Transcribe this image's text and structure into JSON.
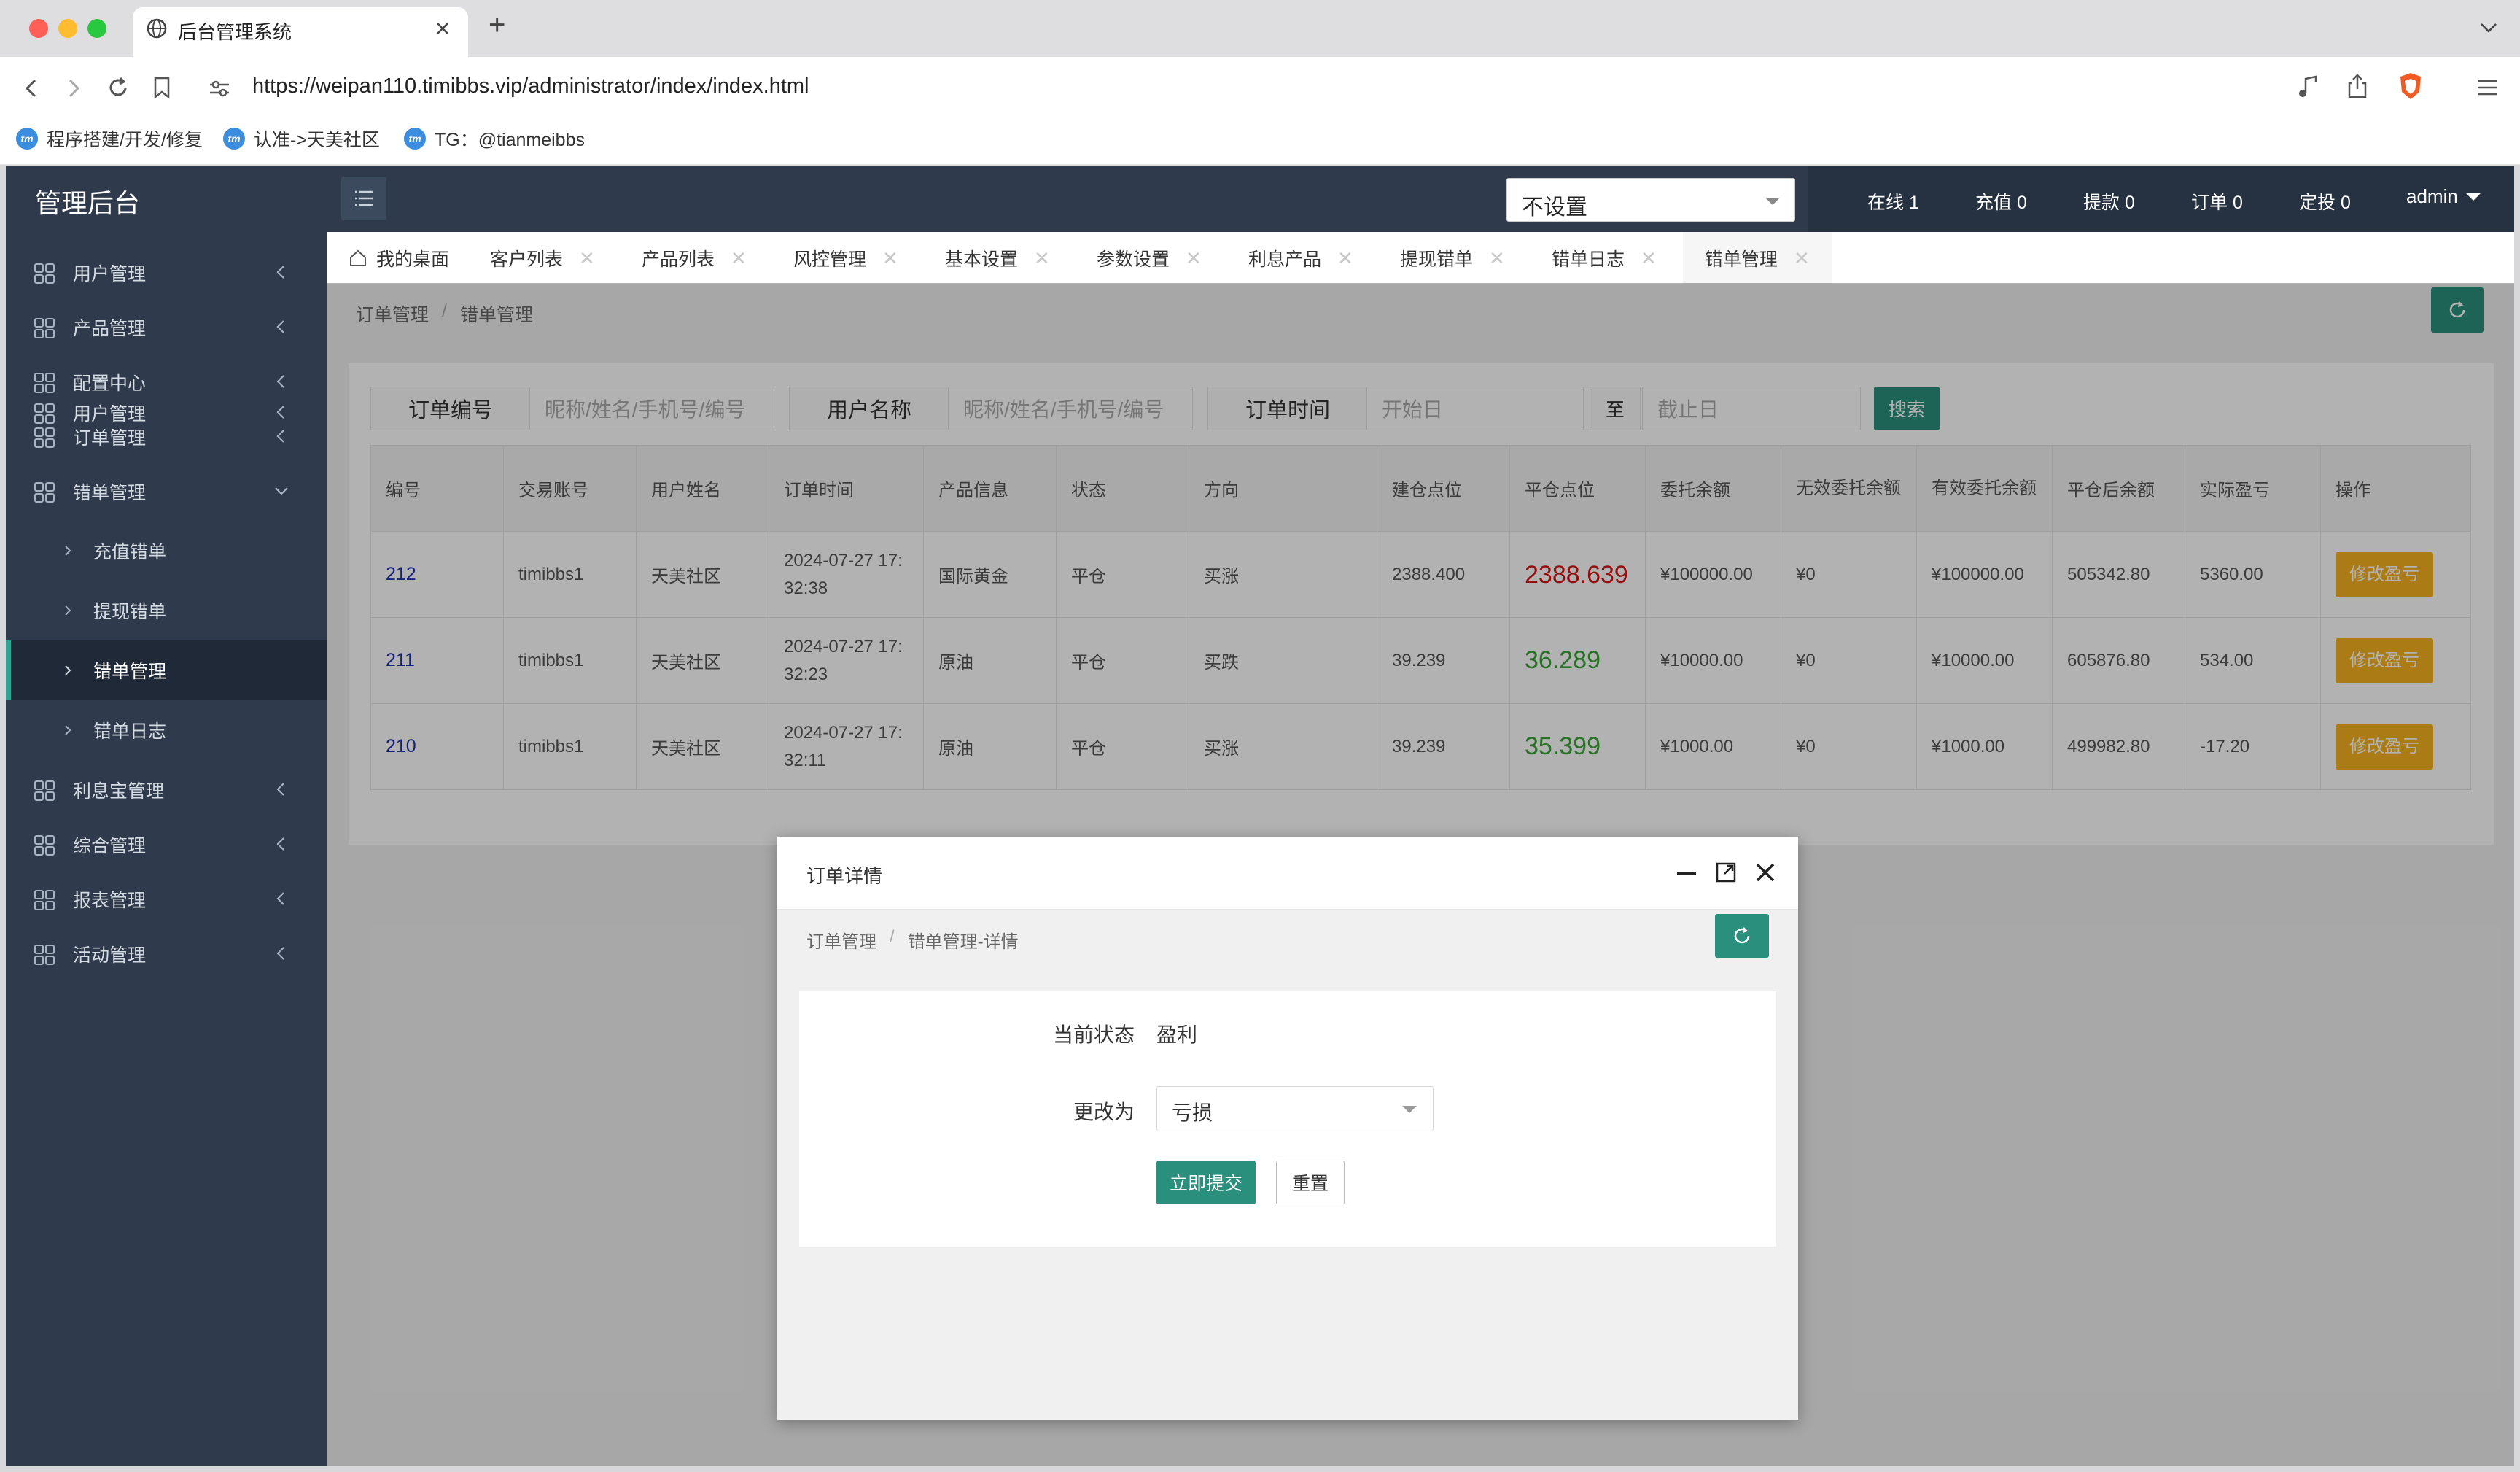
{
  "browser": {
    "tab_title": "后台管理系统",
    "new_tab": "+",
    "url": "https://weipan110.timibbs.vip/administrator/index/index.html",
    "bookmarks": [
      "程序搭建/开发/修复",
      "认准->天美社区",
      "TG：@tianmeibbs"
    ],
    "bookmark_icon_text": "tm"
  },
  "sidebar": {
    "logo": "管理后台",
    "menu": [
      {
        "label": "用户管理"
      },
      {
        "label": "产品管理"
      },
      {
        "label": "配置中心"
      },
      {
        "label": "订单管理"
      },
      {
        "label": "错单管理"
      }
    ],
    "submenu": [
      {
        "label": "充值错单"
      },
      {
        "label": "提现错单"
      },
      {
        "label": "错单管理"
      },
      {
        "label": "错单日志"
      }
    ],
    "menu2": [
      {
        "label": "利息宝管理"
      },
      {
        "label": "综合管理"
      },
      {
        "label": "报表管理"
      },
      {
        "label": "活动管理"
      }
    ]
  },
  "topbar": {
    "select_value": "不设置",
    "stats": [
      "在线 1",
      "充值 0",
      "提款 0",
      "订单 0",
      "定投 0"
    ],
    "user": "admin"
  },
  "tabs": [
    {
      "label": "我的桌面"
    },
    {
      "label": "客户列表"
    },
    {
      "label": "产品列表"
    },
    {
      "label": "风控管理"
    },
    {
      "label": "基本设置"
    },
    {
      "label": "参数设置"
    },
    {
      "label": "利息产品"
    },
    {
      "label": "提现错单"
    },
    {
      "label": "错单日志"
    },
    {
      "label": "错单管理"
    }
  ],
  "breadcrumb": {
    "a": "订单管理",
    "sep": "/",
    "b": "错单管理"
  },
  "search": {
    "order_no_label": "订单编号",
    "order_no_placeholder": "昵称/姓名/手机号/编号",
    "user_label": "用户名称",
    "user_placeholder": "昵称/姓名/手机号/编号",
    "time_label": "订单时间",
    "start_placeholder": "开始日",
    "to": "至",
    "end_placeholder": "截止日",
    "search_button": "搜索"
  },
  "table": {
    "headers": [
      "编号",
      "交易账号",
      "用户姓名",
      "订单时间",
      "产品信息",
      "状态",
      "方向",
      "建仓点位",
      "平仓点位",
      "委托余额",
      "无效委托余额",
      "有效委托余额",
      "平仓后余额",
      "实际盈亏",
      "操作"
    ],
    "rows": [
      {
        "id": "212",
        "account": "timibbs1",
        "name": "天美社区",
        "time": "2024-07-27 17:32:38",
        "product": "国际黄金",
        "status": "平仓",
        "direction": "买涨",
        "open": "2388.400",
        "close": "2388.639",
        "entrust": "¥100000.00",
        "invalid": "¥0",
        "valid": "¥100000.00",
        "after": "505342.80",
        "pnl": "5360.00",
        "action": "修改盈亏"
      },
      {
        "id": "211",
        "account": "timibbs1",
        "name": "天美社区",
        "time": "2024-07-27 17:32:23",
        "product": "原油",
        "status": "平仓",
        "direction": "买跌",
        "open": "39.239",
        "close": "36.289",
        "entrust": "¥10000.00",
        "invalid": "¥0",
        "valid": "¥10000.00",
        "after": "605876.80",
        "pnl": "534.00",
        "action": "修改盈亏"
      },
      {
        "id": "210",
        "account": "timibbs1",
        "name": "天美社区",
        "time": "2024-07-27 17:32:11",
        "product": "原油",
        "status": "平仓",
        "direction": "买涨",
        "open": "39.239",
        "close": "35.399",
        "entrust": "¥1000.00",
        "invalid": "¥0",
        "valid": "¥1000.00",
        "after": "499982.80",
        "pnl": "-17.20",
        "action": "修改盈亏"
      }
    ]
  },
  "dialog": {
    "title": "订单详情",
    "breadcrumb_a": "订单管理",
    "breadcrumb_sep": "/",
    "breadcrumb_b": "错单管理-详情",
    "status_label": "当前状态",
    "status_value": "盈利",
    "change_label": "更改为",
    "change_value": "亏损",
    "submit": "立即提交",
    "reset": "重置"
  },
  "colors": {
    "sidebar_bg": "#2f3b4c",
    "accent_teal": "#2a8f7c",
    "action_orange": "#f5b21f",
    "close_red": "#d41515",
    "close_green": "#3aa336",
    "id_blue": "#1e2bb0"
  }
}
